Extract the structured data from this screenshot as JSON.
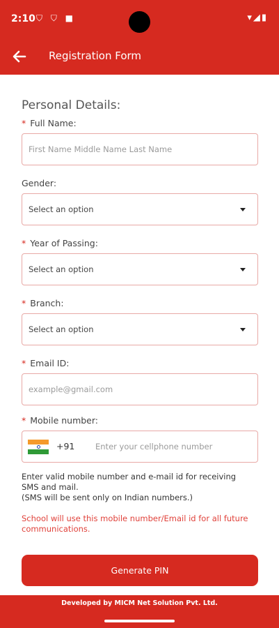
{
  "status_bar": {
    "time": "2:10",
    "left_icons": "⛉ ⛉ ■",
    "right_icons": "▾◢▮"
  },
  "app_bar": {
    "title": "Registration Form"
  },
  "form": {
    "section_title": "Personal Details:",
    "full_name": {
      "required_mark": "*",
      "label": "Full Name:",
      "placeholder": "First Name Middle Name Last Name"
    },
    "gender": {
      "label": "Gender:",
      "selected": "Select an option"
    },
    "year_of_passing": {
      "required_mark": "*",
      "label": "Year of Passing:",
      "selected": "Select an option"
    },
    "branch": {
      "required_mark": "*",
      "label": "Branch:",
      "selected": "Select an option"
    },
    "email": {
      "required_mark": "*",
      "label": "Email ID:",
      "placeholder": "example@gmail.com"
    },
    "mobile": {
      "required_mark": "*",
      "label": "Mobile number:",
      "dial_code": "+91",
      "placeholder": "Enter your cellphone number"
    },
    "info_line1": "Enter valid mobile number and e-mail id for receiving SMS and mail.",
    "info_line2": "(SMS will be sent only on Indian numbers.)",
    "warning": "School will use this mobile number/Email id for all future communications.",
    "submit_label": "Generate PIN"
  },
  "footer": {
    "text": "Developed by MICM Net Solution Pvt. Ltd."
  },
  "colors": {
    "brand": "#d62a20",
    "field_border": "#e8a9a6",
    "warning_text": "#e0413a"
  }
}
